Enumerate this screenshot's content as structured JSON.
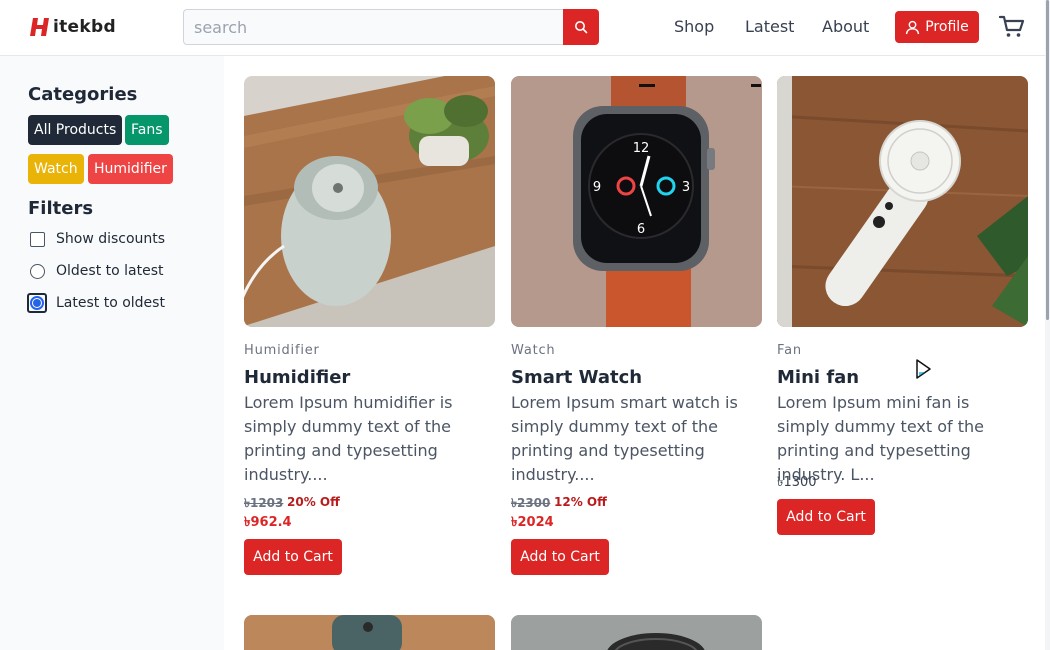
{
  "brand": {
    "logo_text": "itekbd"
  },
  "search": {
    "placeholder": "search"
  },
  "nav": {
    "shop": "Shop",
    "latest": "Latest",
    "about": "About",
    "profile": "Profile"
  },
  "sidebar": {
    "categories_heading": "Categories",
    "categories": [
      {
        "label": "All Products",
        "color": "#1f2937"
      },
      {
        "label": "Fans",
        "color": "#059669"
      },
      {
        "label": "Watch",
        "color": "#eab308"
      },
      {
        "label": "Humidifier",
        "color": "#ef4444"
      }
    ],
    "filters_heading": "Filters",
    "filters": [
      {
        "label": "Show discounts",
        "type": "checkbox",
        "checked": false
      },
      {
        "label": "Oldest to latest",
        "type": "radio",
        "checked": false
      },
      {
        "label": "Latest to oldest",
        "type": "radio",
        "checked": true
      }
    ]
  },
  "products": [
    {
      "category": "Humidifier",
      "title": "Humidifier",
      "description": "Lorem Ipsum humidifier is simply dummy text of the printing and typesetting industry....",
      "old_price": "৳1203",
      "discount": "20% Off",
      "price": "৳962.4",
      "button": "Add to Cart"
    },
    {
      "category": "Watch",
      "title": "Smart Watch",
      "description": "Lorem Ipsum smart watch is simply dummy text of the printing and typesetting industry....",
      "old_price": "৳2300",
      "discount": "12% Off",
      "price": "৳2024",
      "button": "Add to Cart"
    },
    {
      "category": "Fan",
      "title": "Mini fan",
      "description": "Lorem Ipsum mini fan is simply dummy text of the printing and typesetting industry. L...",
      "price": "৳1300",
      "button": "Add to Cart"
    }
  ],
  "colors": {
    "accent": "#dc2626",
    "sidebar_bg": "#f9fafb"
  }
}
